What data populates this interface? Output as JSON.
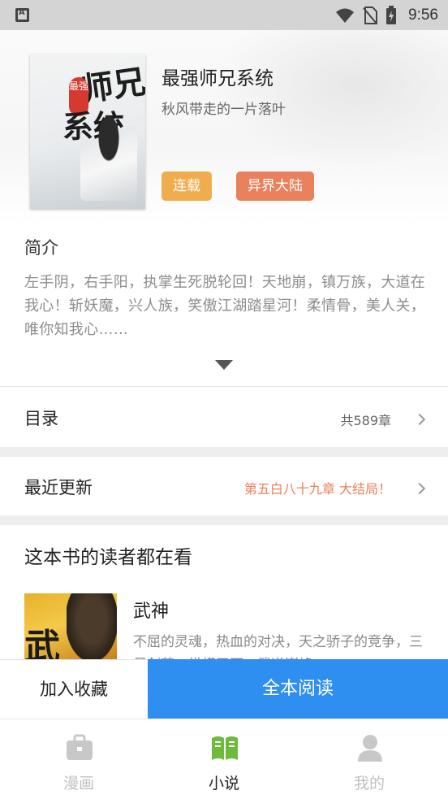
{
  "status_bar": {
    "time": "9:56"
  },
  "book": {
    "title": "最强师兄系统",
    "author": "秋风带走的一片落叶",
    "cover_text": [
      "最强",
      "师兄",
      "系统"
    ],
    "tags": [
      "连载",
      "异界大陆"
    ]
  },
  "intro": {
    "title": "简介",
    "text": "左手阴，右手阳，执掌生死脱轮回！天地崩，镇万族，大道在我心！斩妖魔，兴人族，笑傲江湖踏星河！柔情骨，美人关，唯你知我心……"
  },
  "catalog": {
    "label": "目录",
    "count": "共589章"
  },
  "latest": {
    "label": "最近更新",
    "chapter": "第五白八十九章 大结局！"
  },
  "readers": {
    "title": "这本书的读者都在看",
    "items": [
      {
        "title": "武神",
        "desc": "不屈的灵魂，热血的对决，天之骄子的竞争，三尺剑芒，纵横天下，武道巅峰……",
        "cover_text": "武"
      }
    ]
  },
  "actions": {
    "collect": "加入收藏",
    "read_all": "全本阅读"
  },
  "tabs": [
    {
      "label": "漫画",
      "icon": "briefcase-icon",
      "active": false
    },
    {
      "label": "小说",
      "icon": "book-icon",
      "active": true
    },
    {
      "label": "我的",
      "icon": "person-icon",
      "active": false
    }
  ],
  "colors": {
    "accent": "#2f8ff0",
    "tab_active": "#6dbb3b",
    "tab_inactive": "#c8c8c8",
    "tag_serial": "#f0ad4e",
    "tag_genre": "#e8815c",
    "latest_chapter": "#e8815c"
  }
}
